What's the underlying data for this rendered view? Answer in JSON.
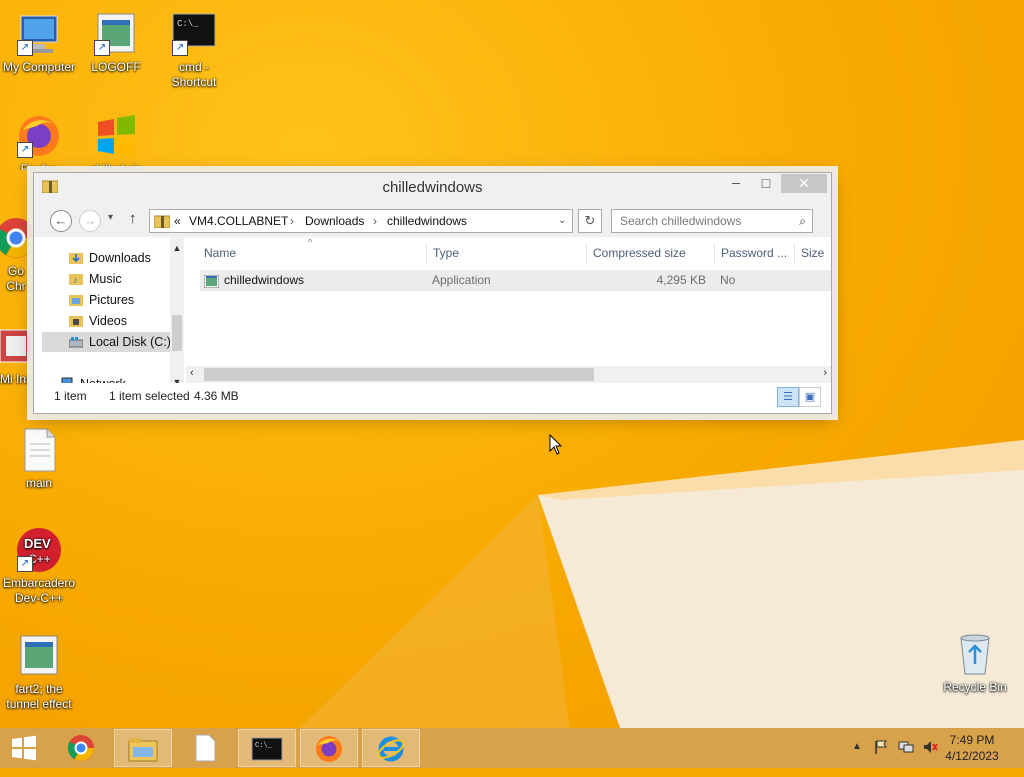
{
  "desktop": {
    "icons": [
      {
        "label": "My Computer",
        "icon": "computer-icon"
      },
      {
        "label": "LOGOFF",
        "icon": "logoff-icon"
      },
      {
        "label": "cmd - Shortcut",
        "icon": "cmd-icon"
      },
      {
        "label": "Firefox",
        "icon": "firefox-icon"
      },
      {
        "label": "chilledwin",
        "icon": "windows-flag-icon"
      },
      {
        "label": "Go Chr",
        "icon": "chrome-icon"
      },
      {
        "label": "Mi Ins",
        "icon": "installer-icon"
      },
      {
        "label": "main",
        "icon": "document-icon"
      },
      {
        "label": "Embarcadero Dev-C++",
        "icon": "devcpp-icon"
      },
      {
        "label": "fart2; the tunnel effect",
        "icon": "application-icon"
      },
      {
        "label": "Recycle Bin",
        "icon": "recycle-bin-icon"
      }
    ]
  },
  "window": {
    "title": "chilledwindows",
    "controls": {
      "minimize": "–",
      "maximize": "□",
      "close": "✕"
    },
    "address": {
      "prefix": "«",
      "segments": [
        "VM4.COLLABNET",
        "Downloads",
        "chilledwindows"
      ],
      "separator": "›"
    },
    "search_placeholder": "Search chilledwindows",
    "nav_pane": {
      "items": [
        {
          "label": "Downloads",
          "icon": "downloads-folder-icon"
        },
        {
          "label": "Music",
          "icon": "music-folder-icon"
        },
        {
          "label": "Pictures",
          "icon": "pictures-folder-icon"
        },
        {
          "label": "Videos",
          "icon": "videos-folder-icon"
        },
        {
          "label": "Local Disk (C:)",
          "icon": "local-disk-icon",
          "selected": true
        },
        {
          "label": "Network",
          "icon": "network-icon"
        }
      ]
    },
    "columns": [
      "Name",
      "Type",
      "Compressed size",
      "Password ...",
      "Size"
    ],
    "rows": [
      {
        "name": "chilledwindows",
        "type": "Application",
        "compressed_size": "4,295 KB",
        "password": "No",
        "size": ""
      }
    ],
    "status": {
      "count": "1 item",
      "selected": "1 item selected",
      "size": "4.36 MB"
    }
  },
  "taskbar": {
    "apps": [
      {
        "name": "start",
        "icon": "windows-start-icon"
      },
      {
        "name": "chrome",
        "icon": "chrome-icon"
      },
      {
        "name": "file-explorer",
        "icon": "file-explorer-icon"
      },
      {
        "name": "blank-document",
        "icon": "document-icon"
      },
      {
        "name": "cmd",
        "icon": "cmd-icon"
      },
      {
        "name": "firefox",
        "icon": "firefox-icon"
      },
      {
        "name": "internet-explorer",
        "icon": "internet-explorer-icon"
      }
    ],
    "clock": {
      "time": "7:49 PM",
      "date": "4/12/2023"
    }
  },
  "colors": {
    "wallpaper": "#f8aa00",
    "taskbar": "#d8a24a",
    "close_button": "#c7c7c7",
    "selection": "#d9d9d9"
  }
}
